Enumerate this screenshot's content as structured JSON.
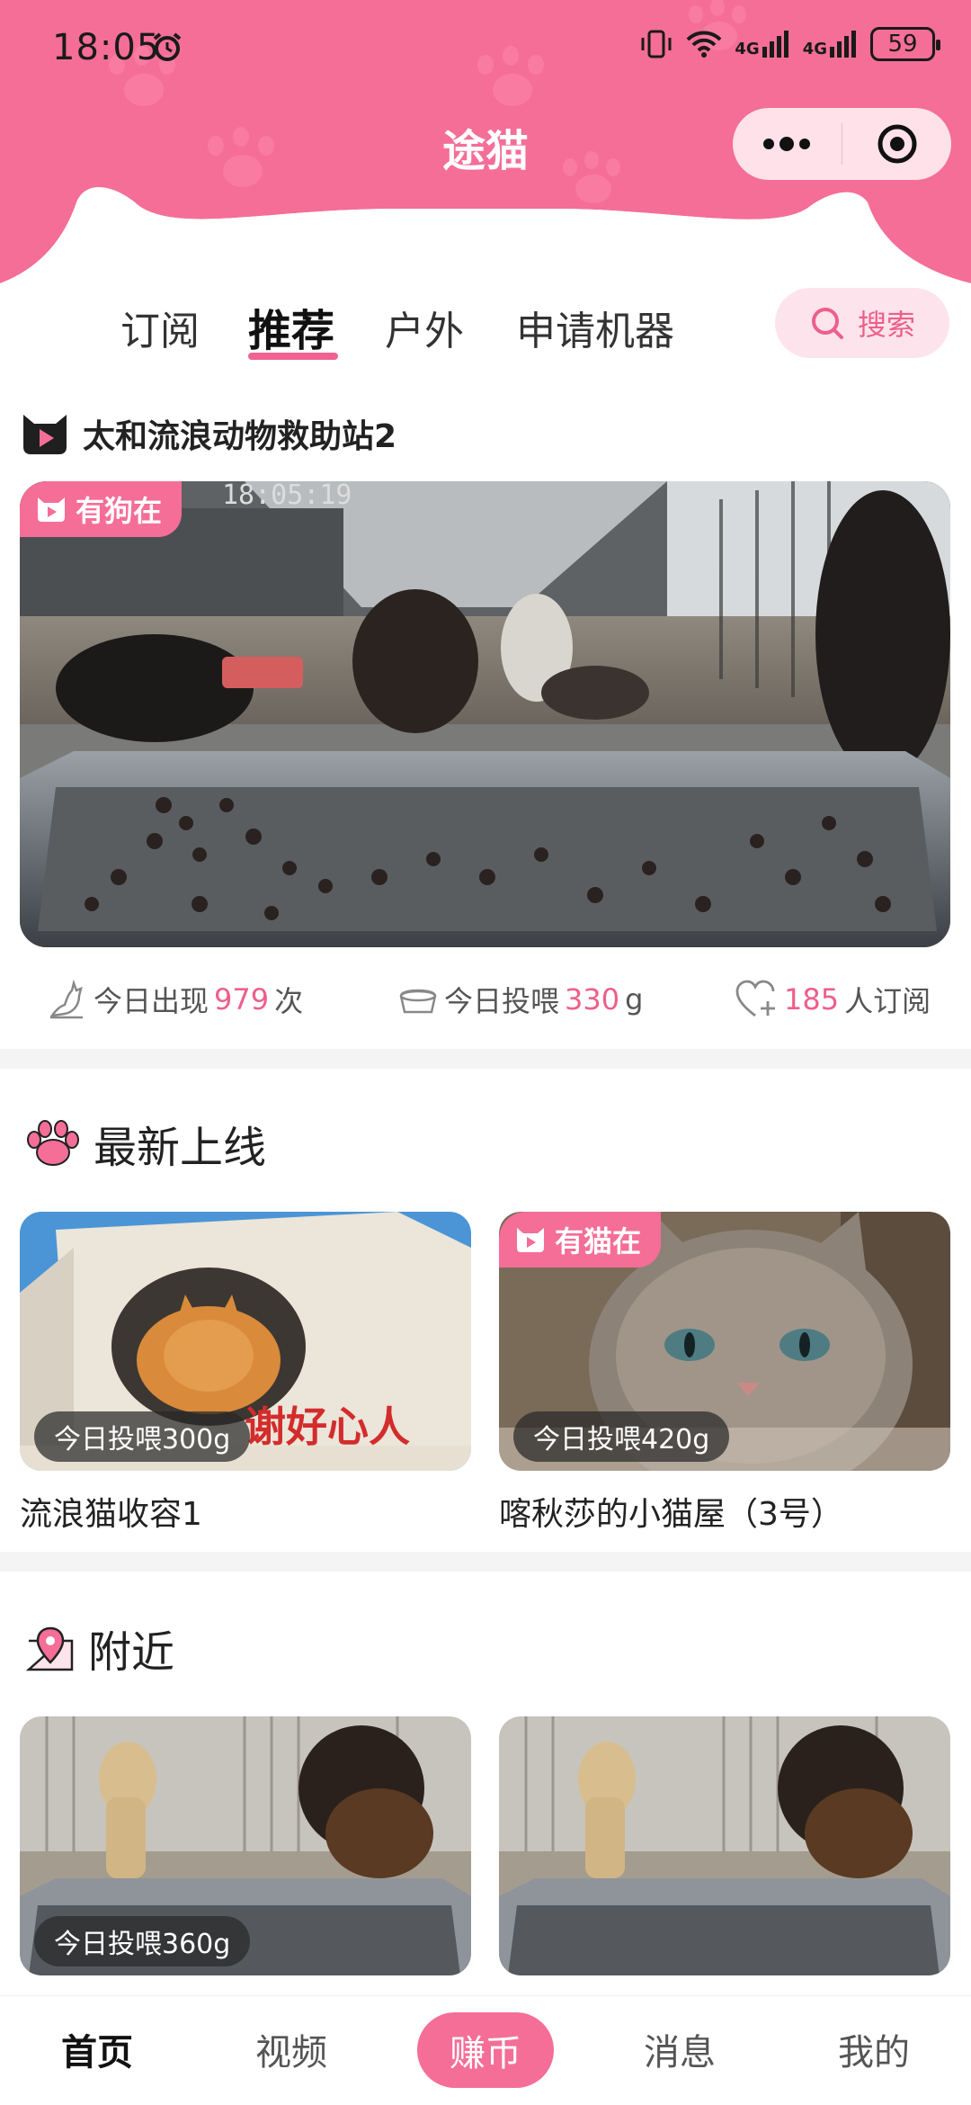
{
  "status_bar": {
    "time": "18:05",
    "battery": "59",
    "network": "4G"
  },
  "app": {
    "title": "途猫"
  },
  "tabs": [
    {
      "label": "订阅"
    },
    {
      "label": "推荐"
    },
    {
      "label": "户外"
    },
    {
      "label": "申请机器"
    }
  ],
  "search": {
    "label": "搜索"
  },
  "featured": {
    "station_name": "太和流浪动物救助站2",
    "video_timestamp": "18:05:19",
    "tag": "有狗在",
    "stats": {
      "appear_prefix": "今日出现",
      "appear_count": "979",
      "appear_suffix": "次",
      "feed_prefix": "今日投喂",
      "feed_amount": "330",
      "feed_unit": "g",
      "sub_count": "185",
      "sub_suffix": "人订阅"
    }
  },
  "latest": {
    "title": "最新上线",
    "cards": [
      {
        "title": "流浪猫收容1",
        "feed": "今日投喂300g",
        "banner": "谢好心人"
      },
      {
        "title": "喀秋莎的小猫屋（3号）",
        "feed": "今日投喂420g",
        "tag": "有猫在"
      }
    ]
  },
  "nearby": {
    "title": "附近",
    "cards": [
      {
        "feed": "今日投喂360g"
      },
      {
        "feed": ""
      }
    ]
  },
  "bottom_nav": {
    "home": "首页",
    "video": "视频",
    "earn": "赚币",
    "messages": "消息",
    "mine": "我的"
  },
  "colors": {
    "brand_pink": "#f46e98",
    "accent_pink": "#ee5f8b"
  }
}
